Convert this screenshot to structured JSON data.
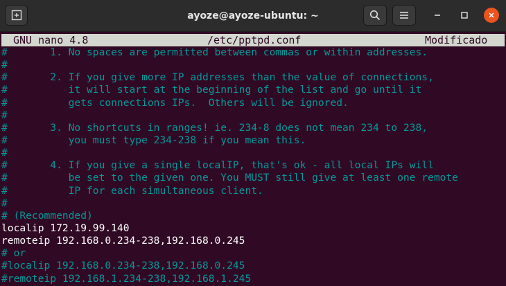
{
  "window": {
    "title": "ayoze@ayoze-ubuntu: ~"
  },
  "icons": {
    "new_tab": "new-tab-icon",
    "search": "search-icon",
    "menu": "hamburger-menu-icon",
    "minimize": "minimize-icon",
    "maximize": "maximize-icon",
    "close": "close-icon"
  },
  "colors": {
    "background": "#300a24",
    "comment": "#06989a",
    "text": "#ffffff",
    "header_bar": "#d3d7cf",
    "close_button": "#e9541f"
  },
  "nano": {
    "version": "GNU nano 4.8",
    "filename": "/etc/pptpd.conf",
    "status": "Modificado"
  },
  "lines": [
    {
      "text": "#       1. No spaces are permitted between commas or within addresses.",
      "type": "comment"
    },
    {
      "text": "#",
      "type": "comment"
    },
    {
      "text": "#       2. If you give more IP addresses than the value of connections,",
      "type": "comment"
    },
    {
      "text": "#          it will start at the beginning of the list and go until it",
      "type": "comment"
    },
    {
      "text": "#          gets connections IPs.  Others will be ignored.",
      "type": "comment"
    },
    {
      "text": "#",
      "type": "comment"
    },
    {
      "text": "#       3. No shortcuts in ranges! ie. 234-8 does not mean 234 to 238,",
      "type": "comment"
    },
    {
      "text": "#          you must type 234-238 if you mean this.",
      "type": "comment"
    },
    {
      "text": "#",
      "type": "comment"
    },
    {
      "text": "#       4. If you give a single localIP, that's ok - all local IPs will",
      "type": "comment"
    },
    {
      "text": "#          be set to the given one. You MUST still give at least one remote",
      "type": "comment"
    },
    {
      "text": "#          IP for each simultaneous client.",
      "type": "comment"
    },
    {
      "text": "#",
      "type": "comment"
    },
    {
      "text": "# (Recommended)",
      "type": "comment"
    },
    {
      "text": "localip 172.19.99.140",
      "type": "normal"
    },
    {
      "text": "remoteip 192.168.0.234-238,192.168.0.245",
      "type": "normal"
    },
    {
      "text": "# or",
      "type": "comment"
    },
    {
      "text": "#localip 192.168.0.234-238,192.168.0.245",
      "type": "comment"
    },
    {
      "text": "#remoteip 192.168.1.234-238,192.168.1.245",
      "type": "comment"
    }
  ]
}
